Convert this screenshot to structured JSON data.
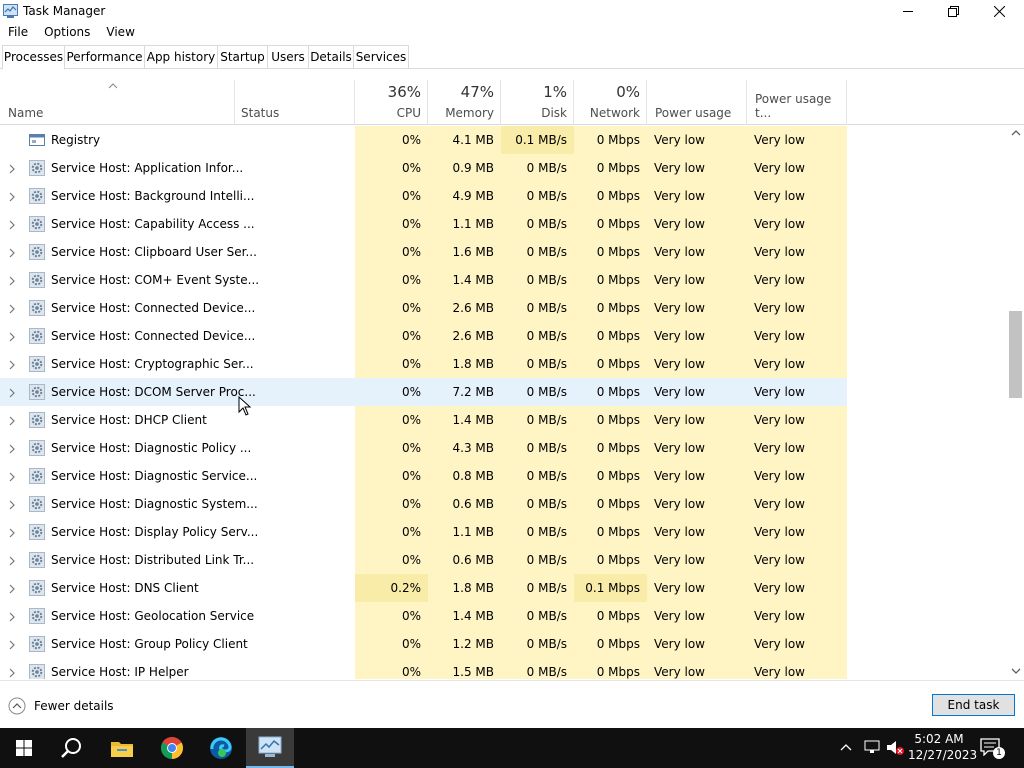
{
  "window": {
    "title": "Task Manager"
  },
  "menu": [
    "File",
    "Options",
    "View"
  ],
  "tabs": [
    "Processes",
    "Performance",
    "App history",
    "Startup",
    "Users",
    "Details",
    "Services"
  ],
  "columns": {
    "name": "Name",
    "status": "Status",
    "cpu": {
      "pct": "36%",
      "label": "CPU"
    },
    "memory": {
      "pct": "47%",
      "label": "Memory"
    },
    "disk": {
      "pct": "1%",
      "label": "Disk"
    },
    "network": {
      "pct": "0%",
      "label": "Network"
    },
    "power": "Power usage",
    "power_trend": "Power usage t..."
  },
  "rows": [
    {
      "name": "Registry",
      "cpu": "0%",
      "mem": "4.1 MB",
      "disk": "0.1 MB/s",
      "net": "0 Mbps",
      "power": "Very low",
      "trend": "Very low",
      "expandable": false,
      "icon": "registry-icon"
    },
    {
      "name": "Service Host: Application Infor...",
      "cpu": "0%",
      "mem": "0.9 MB",
      "disk": "0 MB/s",
      "net": "0 Mbps",
      "power": "Very low",
      "trend": "Very low",
      "expandable": true,
      "icon": "gear-icon"
    },
    {
      "name": "Service Host: Background Intelli...",
      "cpu": "0%",
      "mem": "4.9 MB",
      "disk": "0 MB/s",
      "net": "0 Mbps",
      "power": "Very low",
      "trend": "Very low",
      "expandable": true,
      "icon": "gear-icon"
    },
    {
      "name": "Service Host: Capability Access ...",
      "cpu": "0%",
      "mem": "1.1 MB",
      "disk": "0 MB/s",
      "net": "0 Mbps",
      "power": "Very low",
      "trend": "Very low",
      "expandable": true,
      "icon": "gear-icon"
    },
    {
      "name": "Service Host: Clipboard User Ser...",
      "cpu": "0%",
      "mem": "1.6 MB",
      "disk": "0 MB/s",
      "net": "0 Mbps",
      "power": "Very low",
      "trend": "Very low",
      "expandable": true,
      "icon": "gear-icon"
    },
    {
      "name": "Service Host: COM+ Event Syste...",
      "cpu": "0%",
      "mem": "1.4 MB",
      "disk": "0 MB/s",
      "net": "0 Mbps",
      "power": "Very low",
      "trend": "Very low",
      "expandable": true,
      "icon": "gear-icon"
    },
    {
      "name": "Service Host: Connected Device...",
      "cpu": "0%",
      "mem": "2.6 MB",
      "disk": "0 MB/s",
      "net": "0 Mbps",
      "power": "Very low",
      "trend": "Very low",
      "expandable": true,
      "icon": "gear-icon"
    },
    {
      "name": "Service Host: Connected Device...",
      "cpu": "0%",
      "mem": "2.6 MB",
      "disk": "0 MB/s",
      "net": "0 Mbps",
      "power": "Very low",
      "trend": "Very low",
      "expandable": true,
      "icon": "gear-icon"
    },
    {
      "name": "Service Host: Cryptographic Ser...",
      "cpu": "0%",
      "mem": "1.8 MB",
      "disk": "0 MB/s",
      "net": "0 Mbps",
      "power": "Very low",
      "trend": "Very low",
      "expandable": true,
      "icon": "gear-icon"
    },
    {
      "name": "Service Host: DCOM Server Proc...",
      "cpu": "0%",
      "mem": "7.2 MB",
      "disk": "0 MB/s",
      "net": "0 Mbps",
      "power": "Very low",
      "trend": "Very low",
      "expandable": true,
      "icon": "gear-icon",
      "selected": true
    },
    {
      "name": "Service Host: DHCP Client",
      "cpu": "0%",
      "mem": "1.4 MB",
      "disk": "0 MB/s",
      "net": "0 Mbps",
      "power": "Very low",
      "trend": "Very low",
      "expandable": true,
      "icon": "gear-icon"
    },
    {
      "name": "Service Host: Diagnostic Policy ...",
      "cpu": "0%",
      "mem": "4.3 MB",
      "disk": "0 MB/s",
      "net": "0 Mbps",
      "power": "Very low",
      "trend": "Very low",
      "expandable": true,
      "icon": "gear-icon"
    },
    {
      "name": "Service Host: Diagnostic Service...",
      "cpu": "0%",
      "mem": "0.8 MB",
      "disk": "0 MB/s",
      "net": "0 Mbps",
      "power": "Very low",
      "trend": "Very low",
      "expandable": true,
      "icon": "gear-icon"
    },
    {
      "name": "Service Host: Diagnostic System...",
      "cpu": "0%",
      "mem": "0.6 MB",
      "disk": "0 MB/s",
      "net": "0 Mbps",
      "power": "Very low",
      "trend": "Very low",
      "expandable": true,
      "icon": "gear-icon"
    },
    {
      "name": "Service Host: Display Policy Serv...",
      "cpu": "0%",
      "mem": "1.1 MB",
      "disk": "0 MB/s",
      "net": "0 Mbps",
      "power": "Very low",
      "trend": "Very low",
      "expandable": true,
      "icon": "gear-icon"
    },
    {
      "name": "Service Host: Distributed Link Tr...",
      "cpu": "0%",
      "mem": "0.6 MB",
      "disk": "0 MB/s",
      "net": "0 Mbps",
      "power": "Very low",
      "trend": "Very low",
      "expandable": true,
      "icon": "gear-icon"
    },
    {
      "name": "Service Host: DNS Client",
      "cpu": "0.2%",
      "mem": "1.8 MB",
      "disk": "0 MB/s",
      "net": "0.1 Mbps",
      "power": "Very low",
      "trend": "Very low",
      "expandable": true,
      "icon": "gear-icon"
    },
    {
      "name": "Service Host: Geolocation Service",
      "cpu": "0%",
      "mem": "1.4 MB",
      "disk": "0 MB/s",
      "net": "0 Mbps",
      "power": "Very low",
      "trend": "Very low",
      "expandable": true,
      "icon": "gear-icon"
    },
    {
      "name": "Service Host: Group Policy Client",
      "cpu": "0%",
      "mem": "1.2 MB",
      "disk": "0 MB/s",
      "net": "0 Mbps",
      "power": "Very low",
      "trend": "Very low",
      "expandable": true,
      "icon": "gear-icon"
    },
    {
      "name": "Service Host: IP Helper",
      "cpu": "0%",
      "mem": "1.5 MB",
      "disk": "0 MB/s",
      "net": "0 Mbps",
      "power": "Very low",
      "trend": "Very low",
      "expandable": true,
      "icon": "gear-icon"
    }
  ],
  "footer": {
    "fewer_details": "Fewer details",
    "end_task": "End task"
  },
  "taskbar": {
    "time": "5:02 AM",
    "date": "12/27/2023",
    "notification_count": "1",
    "apps": [
      "windows-start-icon",
      "search-icon",
      "file-explorer-icon",
      "chrome-icon",
      "edge-icon",
      "task-manager-icon"
    ]
  },
  "colors": {
    "cpu_bg": "#fff4c4",
    "accent": "#0078d7",
    "taskbar": "#101010",
    "selected_row": "#e5f1fb"
  }
}
